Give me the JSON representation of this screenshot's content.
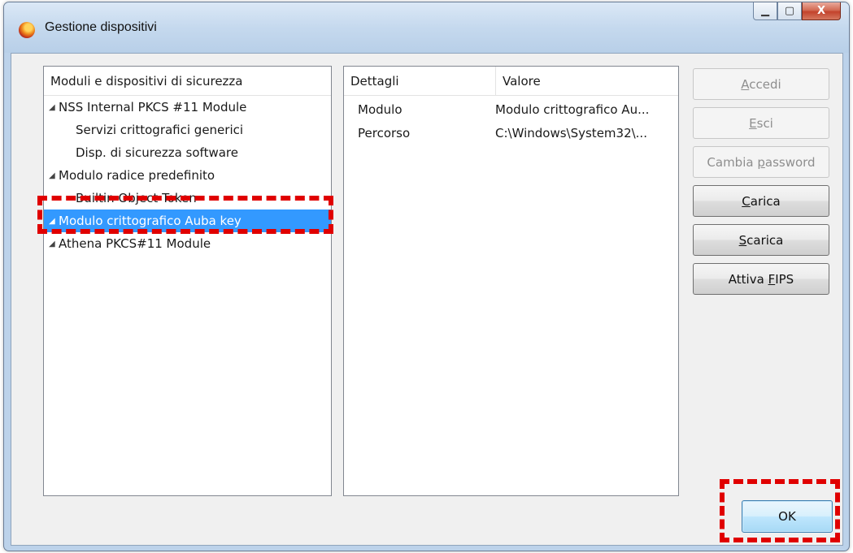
{
  "window": {
    "title": "Gestione dispositivi",
    "minimize_glyph": "▁",
    "maximize_glyph": "▢",
    "close_glyph": "X"
  },
  "tree": {
    "header": "Moduli e dispositivi di sicurezza",
    "items": [
      {
        "label": "NSS Internal PKCS #11 Module",
        "level": 0
      },
      {
        "label": "Servizi crittografici generici",
        "level": 1
      },
      {
        "label": "Disp. di sicurezza software",
        "level": 1
      },
      {
        "label": "Modulo radice predefinito",
        "level": 0
      },
      {
        "label": "Builtin Object Token",
        "level": 1
      },
      {
        "label": "Modulo crittografico Auba key",
        "level": 0,
        "selected": true
      },
      {
        "label": "Athena PKCS#11 Module",
        "level": 0
      }
    ]
  },
  "details": {
    "headers": [
      "Dettagli",
      "Valore"
    ],
    "rows": [
      {
        "key": "Modulo",
        "value": "Modulo crittografico Au..."
      },
      {
        "key": "Percorso",
        "value": "C:\\Windows\\System32\\..."
      }
    ]
  },
  "buttons": {
    "accedi": {
      "label": "Accedi",
      "mnemonic": "A",
      "enabled": false
    },
    "esci": {
      "label": "Esci",
      "mnemonic": "E",
      "enabled": false
    },
    "cambia_password": {
      "label": "Cambia password",
      "mnemonic": "p",
      "enabled": false
    },
    "carica": {
      "label": "Carica",
      "mnemonic": "C",
      "enabled": true
    },
    "scarica": {
      "label": "Scarica",
      "mnemonic": "S",
      "enabled": true
    },
    "attiva_fips": {
      "label": "Attiva FIPS",
      "mnemonic": "F",
      "enabled": true
    },
    "ok": {
      "label": "OK"
    }
  },
  "colors": {
    "selection": "#3399ff",
    "annotation": "#e00000"
  }
}
